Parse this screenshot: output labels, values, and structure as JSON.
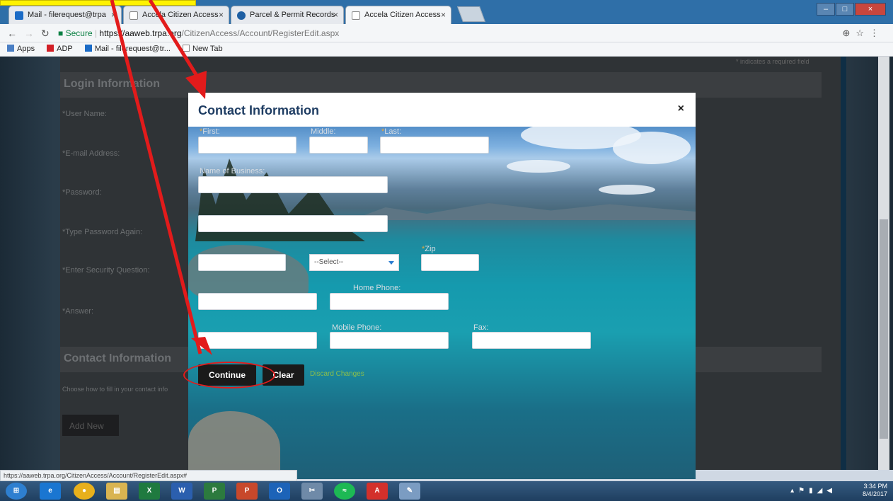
{
  "browser": {
    "tabs": [
      {
        "label": "Mail - filerequest@trpa",
        "icon": "outlook-icon"
      },
      {
        "label": "Accela Citizen Access",
        "icon": "page-icon"
      },
      {
        "label": "Parcel & Permit Records",
        "icon": "parcel-icon"
      },
      {
        "label": "Accela Citizen Access",
        "icon": "page-icon"
      }
    ],
    "address": {
      "secure_label": "Secure",
      "host": "https://aaweb.trpa.org",
      "path": "/CitizenAccess/Account/RegisterEdit.aspx"
    },
    "bookmarks": [
      {
        "label": "Apps",
        "icon": "apps-grid-icon"
      },
      {
        "label": "ADP",
        "icon": "adp-icon"
      },
      {
        "label": "Mail - filerequest@tr...",
        "icon": "outlook-icon"
      },
      {
        "label": "New Tab",
        "icon": "page-icon"
      }
    ],
    "status_url": "https://aaweb.trpa.org/CitizenAccess/Account/RegisterEdit.aspx#"
  },
  "background_page": {
    "required_note": "* indicates a required field",
    "login_section_title": "Login Information",
    "fields": [
      "*User Name:",
      "*E-mail Address:",
      "*Password:",
      "*Type Password Again:",
      "*Enter Security Question:",
      "*Answer:"
    ],
    "contact_section_title": "Contact Information",
    "contact_hint": "Choose how to fill in your contact info",
    "add_new_label": "Add New"
  },
  "modal": {
    "title": "Contact Information",
    "close_symbol": "×",
    "labels": {
      "first": "First:",
      "middle": "Middle:",
      "last": "Last:",
      "business": "Name of Business:",
      "zip": "Zip",
      "home_phone": "Home Phone:",
      "mobile_phone": "Mobile Phone:",
      "fax": "Fax:"
    },
    "required_marker": "*",
    "state_select_value": "--Select--",
    "continue_label": "Continue",
    "clear_label": "Clear",
    "discard_label": "Discard Changes"
  },
  "taskbar": {
    "time": "3:34 PM",
    "date": "8/4/2017",
    "apps": [
      "start-icon",
      "ie-icon",
      "chrome-icon",
      "explorer-icon",
      "excel-icon",
      "word-icon",
      "project-icon",
      "powerpoint-icon",
      "outlook-icon",
      "snipping-icon",
      "spotify-icon",
      "acrobat-icon",
      "paint-icon"
    ]
  },
  "colors": {
    "modal_title": "#1f3d63",
    "required": "#e8a93b",
    "annotation_red": "#e21b1b",
    "callout_yellow": "#fff200",
    "discard_link": "#8bbf4b"
  }
}
